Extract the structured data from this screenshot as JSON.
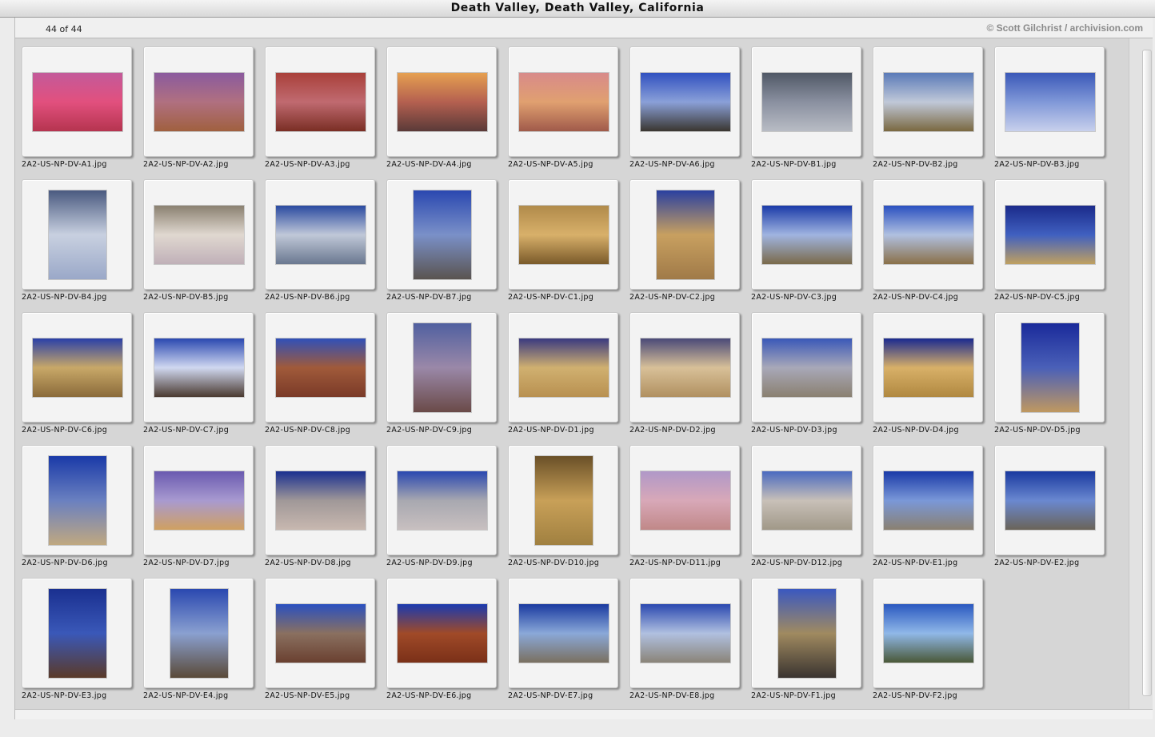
{
  "window": {
    "title": "Death Valley, Death Valley, California"
  },
  "info": {
    "count": "44 of 44",
    "credit": "© Scott Gilchrist / archivision.com"
  },
  "thumbnails": [
    {
      "file": "2A2-US-NP-DV-A1.jpg",
      "orient": "l",
      "colors": [
        "#c35a9a",
        "#e2507e",
        "#b5344f"
      ]
    },
    {
      "file": "2A2-US-NP-DV-A2.jpg",
      "orient": "l",
      "colors": [
        "#8a5a9e",
        "#b07080",
        "#a0603f"
      ]
    },
    {
      "file": "2A2-US-NP-DV-A3.jpg",
      "orient": "l",
      "colors": [
        "#a9403a",
        "#c06a70",
        "#7a2e24"
      ]
    },
    {
      "file": "2A2-US-NP-DV-A4.jpg",
      "orient": "l",
      "colors": [
        "#e6a050",
        "#b46050",
        "#5a3a38"
      ]
    },
    {
      "file": "2A2-US-NP-DV-A5.jpg",
      "orient": "l",
      "colors": [
        "#d88a8a",
        "#e0a070",
        "#a05a4a"
      ]
    },
    {
      "file": "2A2-US-NP-DV-A6.jpg",
      "orient": "l",
      "colors": [
        "#3050c0",
        "#8aa0d8",
        "#3a3630"
      ]
    },
    {
      "file": "2A2-US-NP-DV-B1.jpg",
      "orient": "l",
      "colors": [
        "#505866",
        "#8a90a0",
        "#b8bcc4"
      ]
    },
    {
      "file": "2A2-US-NP-DV-B2.jpg",
      "orient": "l",
      "colors": [
        "#5a7ab8",
        "#c0c8d8",
        "#7a6840"
      ]
    },
    {
      "file": "2A2-US-NP-DV-B3.jpg",
      "orient": "l",
      "colors": [
        "#3a58b8",
        "#8098d8",
        "#c8d0ec"
      ]
    },
    {
      "file": "2A2-US-NP-DV-B4.jpg",
      "orient": "p",
      "colors": [
        "#4a5a80",
        "#c8d0e0",
        "#9aa8c8"
      ]
    },
    {
      "file": "2A2-US-NP-DV-B5.jpg",
      "orient": "l",
      "colors": [
        "#8a8070",
        "#e0d8d0",
        "#c0b0b8"
      ]
    },
    {
      "file": "2A2-US-NP-DV-B6.jpg",
      "orient": "l",
      "colors": [
        "#2a4aa0",
        "#c0c8d8",
        "#6a7890"
      ]
    },
    {
      "file": "2A2-US-NP-DV-B7.jpg",
      "orient": "p",
      "colors": [
        "#2a48b0",
        "#7a90c8",
        "#5a5450"
      ]
    },
    {
      "file": "2A2-US-NP-DV-C1.jpg",
      "orient": "l",
      "colors": [
        "#b08a4a",
        "#d8b06a",
        "#7a5a2a"
      ]
    },
    {
      "file": "2A2-US-NP-DV-C2.jpg",
      "orient": "p",
      "colors": [
        "#2a40a0",
        "#c8a060",
        "#a07a48"
      ]
    },
    {
      "file": "2A2-US-NP-DV-C3.jpg",
      "orient": "l",
      "colors": [
        "#1a3aa8",
        "#a0b4e0",
        "#7a6a4a"
      ]
    },
    {
      "file": "2A2-US-NP-DV-C4.jpg",
      "orient": "l",
      "colors": [
        "#2a50c0",
        "#b0c0e0",
        "#8a7048"
      ]
    },
    {
      "file": "2A2-US-NP-DV-C5.jpg",
      "orient": "l",
      "colors": [
        "#1a2a8a",
        "#4060c0",
        "#c0a060"
      ]
    },
    {
      "file": "2A2-US-NP-DV-C6.jpg",
      "orient": "l",
      "colors": [
        "#2a40a8",
        "#c8a868",
        "#8a6a3a"
      ]
    },
    {
      "file": "2A2-US-NP-DV-C7.jpg",
      "orient": "l",
      "colors": [
        "#2a48b0",
        "#d0d8f0",
        "#4a3a30"
      ]
    },
    {
      "file": "2A2-US-NP-DV-C8.jpg",
      "orient": "l",
      "colors": [
        "#3050b8",
        "#a05a3a",
        "#7a3a28"
      ]
    },
    {
      "file": "2A2-US-NP-DV-C9.jpg",
      "orient": "p",
      "colors": [
        "#5060a0",
        "#9a88a8",
        "#6a4a48"
      ]
    },
    {
      "file": "2A2-US-NP-DV-D1.jpg",
      "orient": "l",
      "colors": [
        "#3a3a80",
        "#d0b070",
        "#b89050"
      ]
    },
    {
      "file": "2A2-US-NP-DV-D2.jpg",
      "orient": "l",
      "colors": [
        "#4a4a78",
        "#d8c098",
        "#b09060"
      ]
    },
    {
      "file": "2A2-US-NP-DV-D3.jpg",
      "orient": "l",
      "colors": [
        "#3a58b8",
        "#a8a8b8",
        "#8a8070"
      ]
    },
    {
      "file": "2A2-US-NP-DV-D4.jpg",
      "orient": "l",
      "colors": [
        "#1a2a90",
        "#d8b068",
        "#b08840"
      ]
    },
    {
      "file": "2A2-US-NP-DV-D5.jpg",
      "orient": "p",
      "colors": [
        "#1a2a9a",
        "#4a60b8",
        "#c09860"
      ]
    },
    {
      "file": "2A2-US-NP-DV-D6.jpg",
      "orient": "p",
      "colors": [
        "#1a3aa8",
        "#6a80c0",
        "#c0a880"
      ]
    },
    {
      "file": "2A2-US-NP-DV-D7.jpg",
      "orient": "l",
      "colors": [
        "#6a5ab0",
        "#a89ad0",
        "#d0a060"
      ]
    },
    {
      "file": "2A2-US-NP-DV-D8.jpg",
      "orient": "l",
      "colors": [
        "#1a3090",
        "#a09898",
        "#c8b8b0"
      ]
    },
    {
      "file": "2A2-US-NP-DV-D9.jpg",
      "orient": "l",
      "colors": [
        "#2a48b0",
        "#a8a8b0",
        "#c8c0c0"
      ]
    },
    {
      "file": "2A2-US-NP-DV-D10.jpg",
      "orient": "p",
      "colors": [
        "#6a5028",
        "#c8a058",
        "#a08040"
      ]
    },
    {
      "file": "2A2-US-NP-DV-D11.jpg",
      "orient": "l",
      "colors": [
        "#b098c8",
        "#d8a8b8",
        "#c08888"
      ]
    },
    {
      "file": "2A2-US-NP-DV-D12.jpg",
      "orient": "l",
      "colors": [
        "#4a6ac0",
        "#c8c0b8",
        "#a09888"
      ]
    },
    {
      "file": "2A2-US-NP-DV-E1.jpg",
      "orient": "l",
      "colors": [
        "#1a3aa8",
        "#7a98d8",
        "#8a8070"
      ]
    },
    {
      "file": "2A2-US-NP-DV-E2.jpg",
      "orient": "l",
      "colors": [
        "#1a3aa0",
        "#6a88d0",
        "#6a6458"
      ]
    },
    {
      "file": "2A2-US-NP-DV-E3.jpg",
      "orient": "p",
      "colors": [
        "#1a3090",
        "#3a58b8",
        "#5a3a28"
      ]
    },
    {
      "file": "2A2-US-NP-DV-E4.jpg",
      "orient": "p",
      "colors": [
        "#2a48b0",
        "#8aa0d0",
        "#5a4a38"
      ]
    },
    {
      "file": "2A2-US-NP-DV-E5.jpg",
      "orient": "l",
      "colors": [
        "#2a50c0",
        "#8a7060",
        "#6a4030"
      ]
    },
    {
      "file": "2A2-US-NP-DV-E6.jpg",
      "orient": "l",
      "colors": [
        "#1a3ab0",
        "#a04a28",
        "#7a3018"
      ]
    },
    {
      "file": "2A2-US-NP-DV-E7.jpg",
      "orient": "l",
      "colors": [
        "#1a3aa0",
        "#8aa8d8",
        "#7a7060"
      ]
    },
    {
      "file": "2A2-US-NP-DV-E8.jpg",
      "orient": "l",
      "colors": [
        "#2a48b0",
        "#b0c0e0",
        "#8a8478"
      ]
    },
    {
      "file": "2A2-US-NP-DV-F1.jpg",
      "orient": "p",
      "colors": [
        "#3a58c0",
        "#a08a60",
        "#3a3430"
      ]
    },
    {
      "file": "2A2-US-NP-DV-F2.jpg",
      "orient": "l",
      "colors": [
        "#2a58c0",
        "#90b8e8",
        "#4a5838"
      ]
    }
  ]
}
